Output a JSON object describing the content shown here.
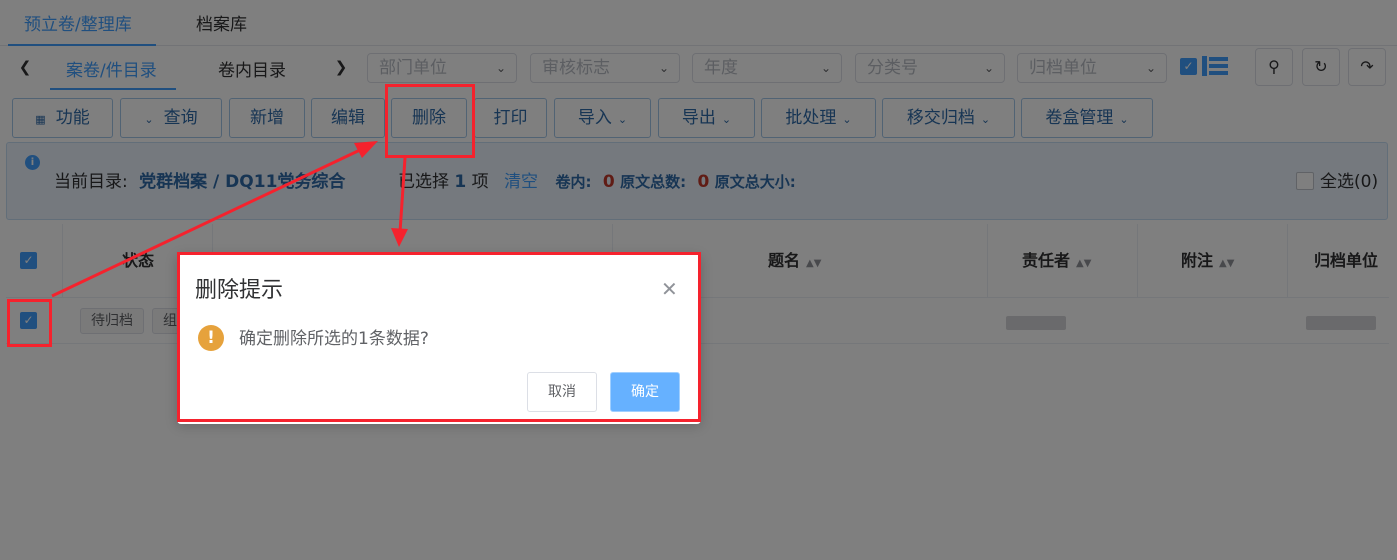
{
  "top_tabs": [
    "预立卷/整理库",
    "档案库"
  ],
  "sub_tabs": [
    "案卷/件目录",
    "卷内目录"
  ],
  "filters": {
    "department": "部门单位",
    "review_flag": "审核标志",
    "year": "年度",
    "category": "分类号",
    "archive_unit": "归档单位"
  },
  "toolbar": {
    "function": "功能",
    "query": "查询",
    "add": "新增",
    "edit": "编辑",
    "delete": "删除",
    "print": "打印",
    "import": "导入",
    "export": "导出",
    "batch": "批处理",
    "transfer": "移交归档",
    "box": "卷盒管理"
  },
  "info": {
    "current_label": "当前目录:",
    "current_path": "党群档案 / DQ11党务综合",
    "selected_prefix": "已选择",
    "selected_count": "1",
    "selected_suffix": "项",
    "clear": "清空",
    "volume_label": "卷内:",
    "volume_count": "0",
    "original_total_label": "原文总数:",
    "original_total": "0",
    "original_size_label": "原文总大小:",
    "select_all": "全选(0)"
  },
  "table": {
    "headers": {
      "status": "状态",
      "title": "题名",
      "responsible": "责任者",
      "note": "附注",
      "archive_unit": "归档单位"
    },
    "row": {
      "status_tag": "待归档",
      "tag2": "组"
    }
  },
  "dialog": {
    "title": "删除提示",
    "message": "确定删除所选的1条数据?",
    "cancel": "取消",
    "confirm": "确定"
  },
  "colors": {
    "accent": "#409eff",
    "highlight": "#f5222d",
    "warning": "#e6a23c"
  }
}
